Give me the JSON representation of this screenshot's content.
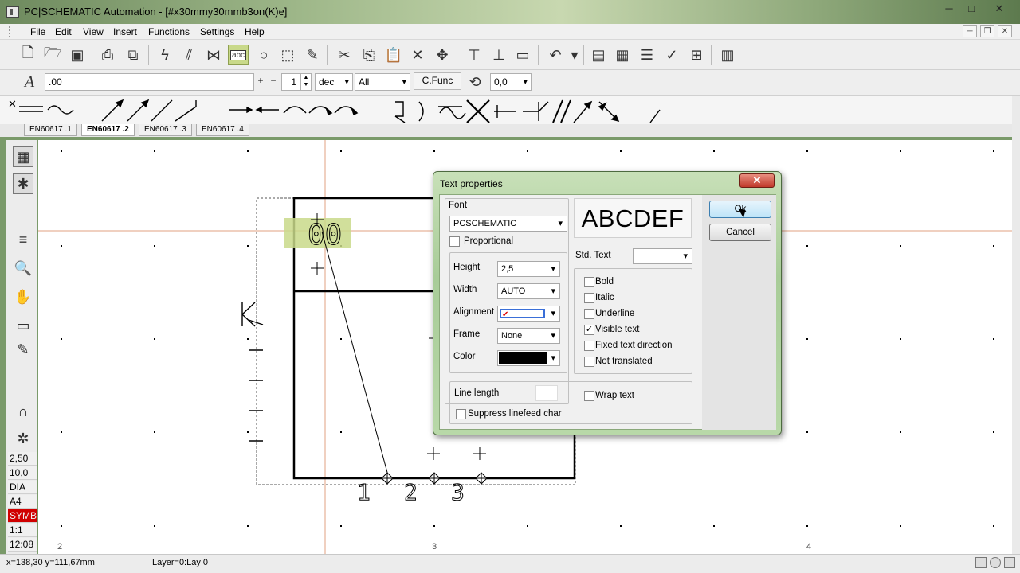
{
  "window": {
    "title": "PC|SCHEMATIC Automation - [#x30mmy30mmb3on(K)e]",
    "min": "─",
    "max": "□",
    "close": "✕"
  },
  "menu": {
    "items": [
      "File",
      "Edit",
      "View",
      "Insert",
      "Functions",
      "Settings",
      "Help"
    ],
    "mdi": {
      "min": "─",
      "restore": "❐",
      "close": "✕"
    }
  },
  "toolbar2": {
    "text_field": ".00",
    "plus": "+",
    "minus": "−",
    "step_value": "1",
    "unit": "dec",
    "layer_filter": "All",
    "cfunc_label": "C.Func",
    "angle_value": "0,0"
  },
  "sheet_tabs": [
    "EN60617 .1",
    "EN60617 .2",
    "EN60617 .3",
    "EN60617 .4"
  ],
  "active_tab": 1,
  "left_status": [
    "2,50",
    "10,0",
    "DIA",
    "A4",
    "SYMB",
    "1:1",
    "12:08"
  ],
  "canvas": {
    "col_labels": [
      "2",
      "3",
      "4"
    ],
    "drawing_text": "00",
    "pin_labels": [
      "1",
      "2",
      "3"
    ]
  },
  "statusbar": {
    "coords": "x=138,30 y=111,67mm",
    "layer": "Layer=0:Lay 0"
  },
  "dialog": {
    "title": "Text properties",
    "close": "✕",
    "font_label": "Font",
    "font_value": "PCSCHEMATIC",
    "proportional_label": "Proportional",
    "preview_text": "ABCDEF",
    "std_text_label": "Std. Text",
    "height_label": "Height",
    "height_value": "2,5",
    "width_label": "Width",
    "width_value": "AUTO",
    "alignment_label": "Alignment",
    "frame_label": "Frame",
    "frame_value": "None",
    "color_label": "Color",
    "color_value": "#000000",
    "bold_label": "Bold",
    "italic_label": "Italic",
    "underline_label": "Underline",
    "visible_text_label": "Visible text",
    "visible_text_checked": true,
    "fixed_dir_label": "Fixed text direction",
    "not_translated_label": "Not translated",
    "line_length_label": "Line length",
    "wrap_text_label": "Wrap text",
    "suppress_label": "Suppress linefeed char",
    "ok_label": "Ok",
    "cancel_label": "Cancel"
  },
  "colors": {
    "highlight": "#c9d98a",
    "symb_red": "#d00000",
    "crosshair": "#e0a080"
  }
}
